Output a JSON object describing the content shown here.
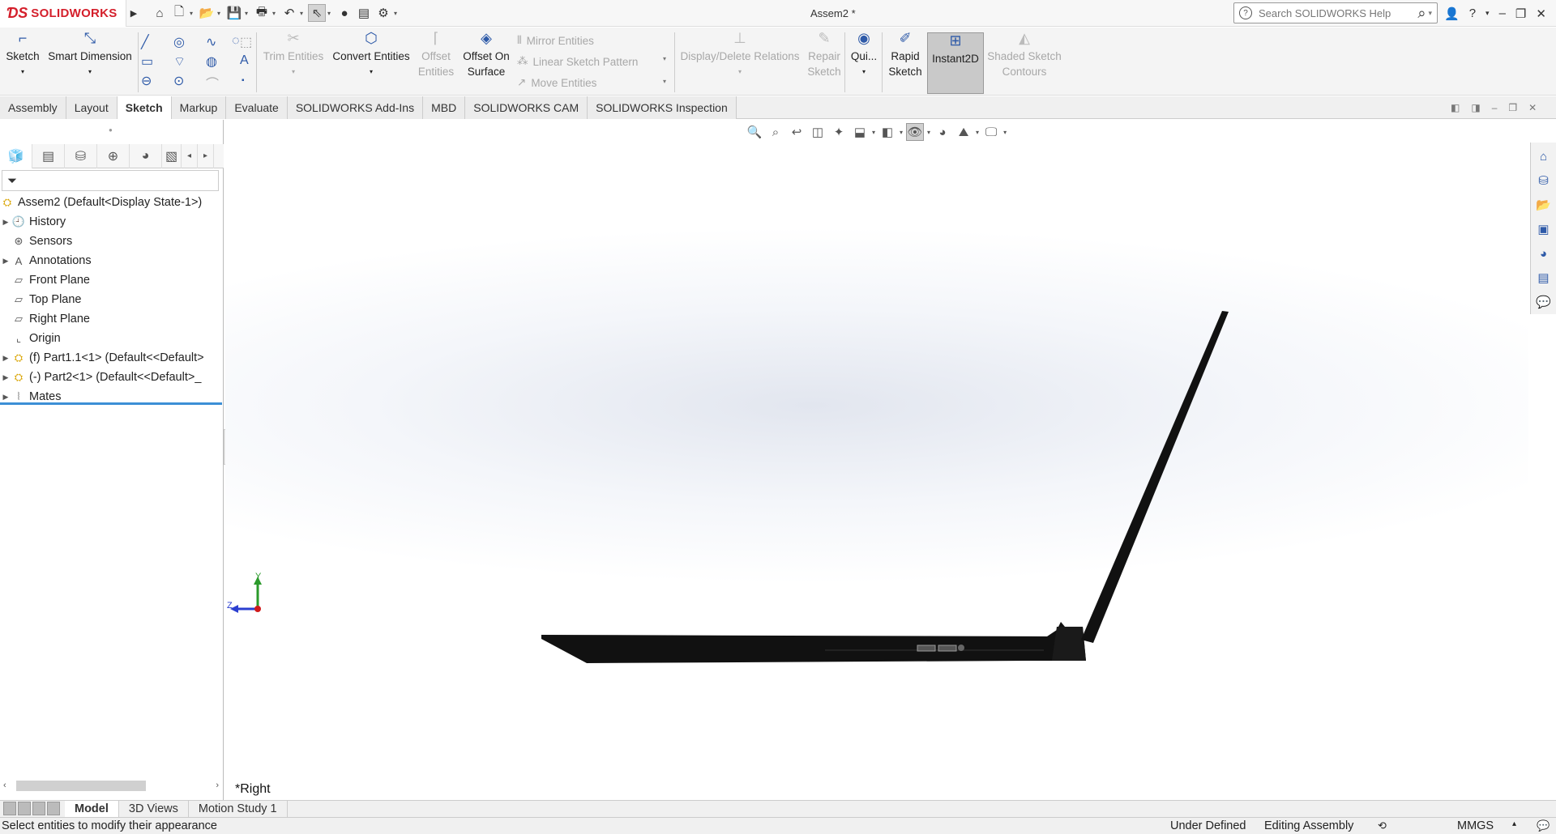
{
  "titlebar": {
    "brand": "SOLIDWORKS",
    "document_title": "Assem2 *",
    "search_placeholder": "Search SOLIDWORKS Help"
  },
  "commands": {
    "sketch": "Sketch",
    "smart_dimension": "Smart Dimension",
    "trim_entities": "Trim Entities",
    "convert_entities": "Convert Entities",
    "offset_entities_1": "Offset",
    "offset_entities_2": "Entities",
    "offset_on_surface_1": "Offset On",
    "offset_on_surface_2": "Surface",
    "mirror_entities": "Mirror Entities",
    "linear_sketch_pattern": "Linear Sketch Pattern",
    "move_entities": "Move Entities",
    "display_delete_relations": "Display/Delete Relations",
    "repair_sketch_1": "Repair",
    "repair_sketch_2": "Sketch",
    "quick_snaps": "Qui...",
    "rapid_sketch_1": "Rapid",
    "rapid_sketch_2": "Sketch",
    "instant2d": "Instant2D",
    "shaded_sketch_1": "Shaded Sketch",
    "shaded_sketch_2": "Contours"
  },
  "tabs": [
    "Assembly",
    "Layout",
    "Sketch",
    "Markup",
    "Evaluate",
    "SOLIDWORKS Add-Ins",
    "MBD",
    "SOLIDWORKS CAM",
    "SOLIDWORKS Inspection"
  ],
  "active_tab": "Sketch",
  "tree": {
    "root": "Assem2  (Default<Display State-1>)",
    "items": [
      {
        "label": "History",
        "expandable": true
      },
      {
        "label": "Sensors",
        "expandable": false
      },
      {
        "label": "Annotations",
        "expandable": true
      },
      {
        "label": "Front Plane",
        "expandable": false
      },
      {
        "label": "Top Plane",
        "expandable": false
      },
      {
        "label": "Right Plane",
        "expandable": false
      },
      {
        "label": "Origin",
        "expandable": false
      },
      {
        "label": "(f) Part1.1<1> (Default<<Default>",
        "expandable": true
      },
      {
        "label": "(-) Part2<1> (Default<<Default>_",
        "expandable": true
      },
      {
        "label": "Mates",
        "expandable": true
      }
    ]
  },
  "viewport": {
    "view_name": "*Right",
    "triad_y": "Y",
    "triad_z": "Z"
  },
  "bottom_tabs": [
    "Model",
    "3D Views",
    "Motion Study 1"
  ],
  "active_bottom_tab": "Model",
  "status": {
    "message": "Select entities to modify their appearance",
    "sketch_state": "Under Defined",
    "mode": "Editing Assembly",
    "units": "MMGS"
  },
  "colors": {
    "brand_red": "#d41f2b",
    "accent_blue": "#3c8fd6",
    "model_black": "#111111"
  }
}
